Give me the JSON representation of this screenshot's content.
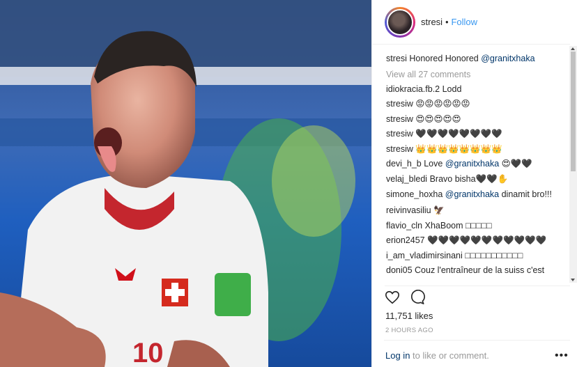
{
  "header": {
    "username": "stresi",
    "separator": "•",
    "follow_label": "Follow"
  },
  "caption": {
    "user": "stresi",
    "text": "Honored Honored",
    "mention": "@granitxhaka"
  },
  "view_all_label": "View all 27 comments",
  "comments": [
    {
      "user": "idiokracia.fb.2",
      "text": "Lodd"
    },
    {
      "user": "stresiw",
      "text": "😡😡😡😡😡😡"
    },
    {
      "user": "stresiw",
      "text": "😍😍😍😍😍"
    },
    {
      "user": "stresiw",
      "text": "🖤🖤🖤🖤🖤🖤🖤🖤"
    },
    {
      "user": "stresiw",
      "text": "👑👑👑👑👑👑👑👑"
    },
    {
      "user": "devi_h_b",
      "text": "Love",
      "mention": "@granitxhaka",
      "tail": "😍🖤🖤"
    },
    {
      "user": "velaj_bledi",
      "text": "Bravo bisha🖤🖤✋"
    },
    {
      "user": "simone_hoxha",
      "mention": "@granitxhaka",
      "tail": "dinamit bro!!!",
      "wrap": true
    },
    {
      "user": "reivinvasiliu",
      "text": "🦅"
    },
    {
      "user": "flavio_cln",
      "text": "XhaBoom □□□□□"
    },
    {
      "user": "erion2457",
      "text": "🖤🖤🖤🖤🖤🖤🖤🖤🖤🖤🖤"
    },
    {
      "user": "i_am_vladimirsinani",
      "text": "□□□□□□□□□□□"
    },
    {
      "user": "doni05",
      "text": "Couz l'entraîneur de la suiss c'est"
    }
  ],
  "likes_label": "11,751 likes",
  "time_label": "2 HOURS AGO",
  "login": {
    "link": "Log in",
    "text": "to like or comment."
  },
  "more_label": "•••",
  "icons": {
    "like": "heart-icon",
    "comment": "comment-icon"
  }
}
